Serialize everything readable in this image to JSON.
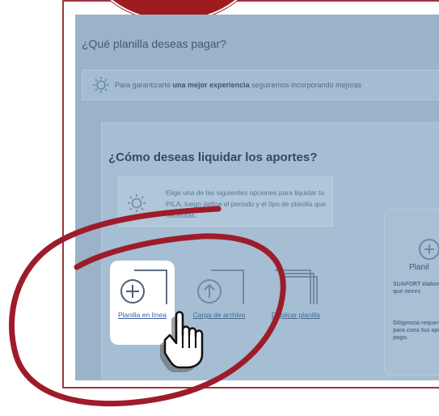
{
  "page": {
    "question": "¿Qué planilla deseas pagar?",
    "banner": {
      "prefix": "Para garantizarte ",
      "bold": "una mejor experiencia",
      "suffix": " seguiremos incorporando mejoras",
      "icon": "sun-icon"
    },
    "card": {
      "title": "¿Cómo deseas liquidar los aportes?",
      "info": "Elige una de las siguientes opciones para liquidar tu PILA, luego define el periodo y el tipo de planilla que necesitas.",
      "options": [
        {
          "label": "Planilla en línea",
          "icon": "plus-document-icon",
          "selected": true
        },
        {
          "label": "Carga de archivo",
          "icon": "upload-document-icon",
          "selected": false
        },
        {
          "label": "Duplicar planilla",
          "icon": "duplicate-document-icon",
          "selected": false
        }
      ]
    },
    "right_card": {
      "title": "Planil",
      "desc": "SUAPORT elaboració que neces",
      "desc2": "Diligencia requerido para cons tus aporte pago."
    }
  },
  "colors": {
    "annotation": "#9e1c2a",
    "overlay": "#9ab3c9",
    "link": "#3a5fa0"
  }
}
